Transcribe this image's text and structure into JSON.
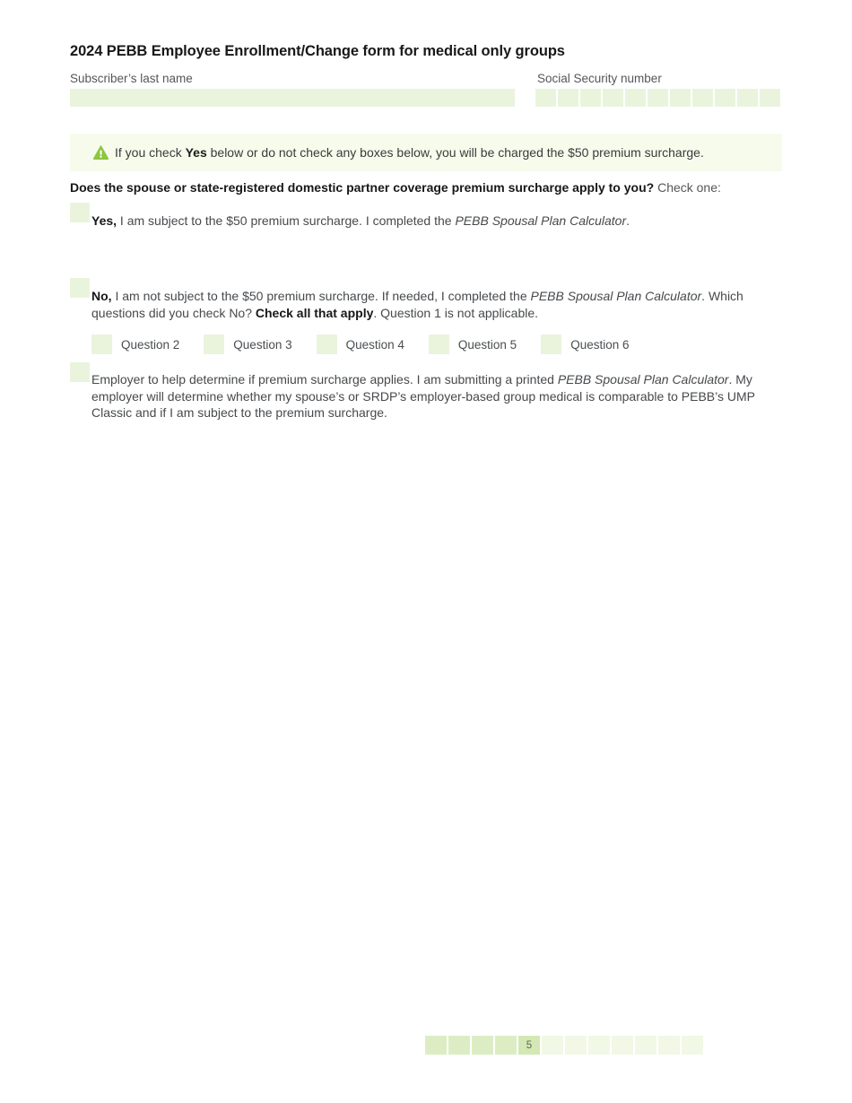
{
  "document": {
    "title": "2024 PEBB Employee Enrollment/Change form for medical only groups"
  },
  "header": {
    "lastname_label": "Subscriber’s last name",
    "lastname_value": "",
    "ssn_label": "Social Security number",
    "ssn_boxes": [
      "",
      "",
      "",
      "",
      "",
      "",
      "",
      "",
      "",
      "",
      ""
    ]
  },
  "warning": {
    "icon": "warning-triangle-icon",
    "text_before": "If you check ",
    "text_bold": "Yes",
    "text_after": " below or do not check any boxes below, you will be charged the $50 premium surcharge."
  },
  "question": {
    "bold": "Does the spouse or state-registered domestic partner coverage premium surcharge apply to you?",
    "light": " Check one:"
  },
  "options": {
    "yes": {
      "bold": "Yes,",
      "plain": " I am subject to the $50 premium surcharge. I completed the ",
      "italic": "PEBB Spousal Plan Calculator",
      "tail": "."
    },
    "no": {
      "bold": "No,",
      "plain": " I am not subject to the $50 premium surcharge. If needed, I completed the ",
      "italic": "PEBB Spousal Plan Calculator",
      "tail": ". Which questions did you check No? ",
      "bold2": "Check all that apply",
      "tail2": ". Question 1 is not applicable."
    },
    "employer": {
      "plain": " Employer to help determine if premium surcharge applies. I am submitting a printed ",
      "italic": "PEBB Spousal Plan Calculator",
      "tail": ". My employer will determine whether my spouse’s or SRDP’s employer-based group medical is comparable to PEBB’s UMP Classic and if I am subject to the premium surcharge."
    }
  },
  "question_checkboxes": [
    {
      "label": "Question 2",
      "checked": false
    },
    {
      "label": "Question 3",
      "checked": false
    },
    {
      "label": "Question 4",
      "checked": false
    },
    {
      "label": "Question 5",
      "checked": false
    },
    {
      "label": "Question 6",
      "checked": false
    }
  ],
  "footer": {
    "current_page": "5",
    "total_boxes": 12,
    "completed_boxes": 4,
    "pages": [
      "",
      "",
      "",
      "",
      "5",
      "",
      "",
      "",
      "",
      "",
      "",
      ""
    ]
  },
  "colors": {
    "field_fill": "#eaf4dd",
    "banner_bg": "#f6fbec",
    "accent_green": "#8ec63f",
    "pager_done": "#dcedc4",
    "pager_current": "#d3e8b4",
    "pager_empty": "#f1f8e6"
  }
}
